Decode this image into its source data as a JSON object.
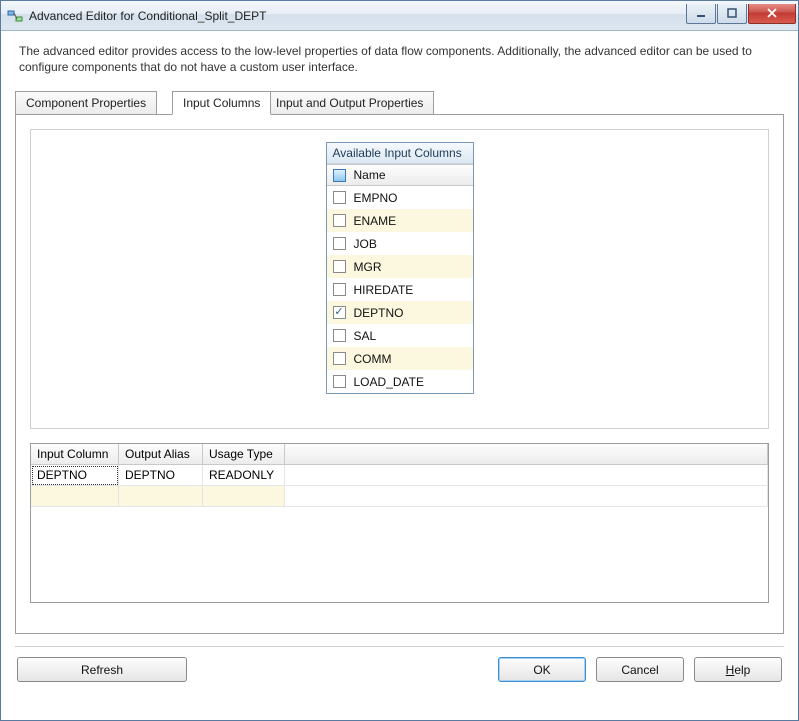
{
  "window": {
    "title": "Advanced Editor for Conditional_Split_DEPT"
  },
  "description": "The advanced editor provides access to the low-level properties of data flow components. Additionally, the advanced editor can be used to configure components that do not have a custom user interface.",
  "tabs": {
    "component_properties": "Component Properties",
    "input_columns": "Input Columns",
    "io_properties": "Input and Output Properties"
  },
  "columns_box": {
    "title": "Available Input Columns",
    "name_header": "Name",
    "items": [
      {
        "label": "EMPNO",
        "checked": false
      },
      {
        "label": "ENAME",
        "checked": false
      },
      {
        "label": "JOB",
        "checked": false
      },
      {
        "label": "MGR",
        "checked": false
      },
      {
        "label": "HIREDATE",
        "checked": false
      },
      {
        "label": "DEPTNO",
        "checked": true
      },
      {
        "label": "SAL",
        "checked": false
      },
      {
        "label": "COMM",
        "checked": false
      },
      {
        "label": "LOAD_DATE",
        "checked": false
      }
    ]
  },
  "grid": {
    "headers": {
      "input_column": "Input Column",
      "output_alias": "Output Alias",
      "usage_type": "Usage Type"
    },
    "rows": [
      {
        "input_column": "DEPTNO",
        "output_alias": "DEPTNO",
        "usage_type": "READONLY"
      }
    ]
  },
  "buttons": {
    "refresh": "Refresh",
    "ok": "OK",
    "cancel": "Cancel",
    "help_prefix": "H",
    "help_rest": "elp"
  }
}
